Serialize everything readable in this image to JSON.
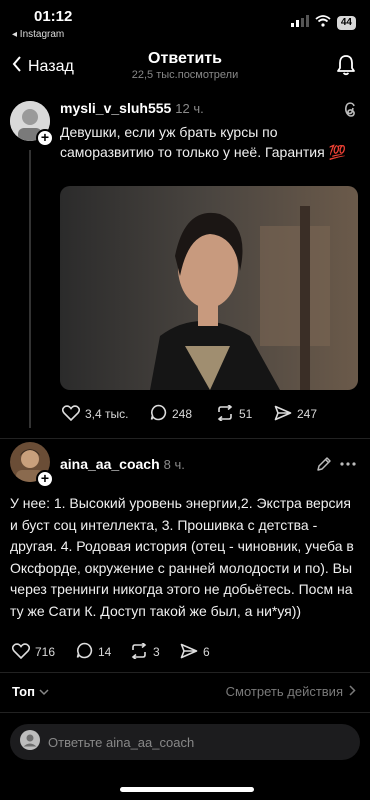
{
  "status_bar": {
    "time": "01:12",
    "back_app": "◂ Instagram",
    "battery": "44",
    "icons": [
      "signal-icon",
      "wifi-icon",
      "battery-icon"
    ]
  },
  "nav": {
    "back_label": "Назад",
    "title": "Ответить",
    "subtitle": "22,5 тыс.посмотрели",
    "icons": [
      "chevron-left-icon",
      "bell-icon"
    ]
  },
  "post": {
    "username": "mysli_v_sluh555",
    "time": "12 ч.",
    "text": "Девушки, если уж брать курсы по саморазвитию то только у неё. Гарантия 💯",
    "icons": [
      "threads-logo-icon"
    ],
    "actions": {
      "likes": "3,4 тыс.",
      "comments": "248",
      "reposts": "51",
      "shares": "247"
    }
  },
  "reply": {
    "username": "aina_aa_coach",
    "time": "8 ч.",
    "text": "У нее: 1. Высокий уровень энергии,2. Экстра версия и буст соц интеллекта, 3. Прошивка с детства - другая. 4. Родовая история (отец - чиновник, учеба в Оксфорде, окружение с ранней молодости и по). Вы через тренинги никогда этого не добьётесь. Посм на ту же Сати К. Доступ такой же был, а ни*уя))",
    "icons": [
      "pencil-icon",
      "more-icon"
    ],
    "actions": {
      "likes": "716",
      "comments": "14",
      "reposts": "3",
      "shares": "6"
    }
  },
  "footer": {
    "sort_label": "Топ",
    "view_actions_label": "Смотреть действия"
  },
  "reply_bar": {
    "placeholder": "Ответьте aina_aa_coach"
  },
  "colors": {
    "background": "#000000",
    "text": "#f2f2f2",
    "muted": "#8a8a8a",
    "input_bg": "#1c1c1e"
  }
}
